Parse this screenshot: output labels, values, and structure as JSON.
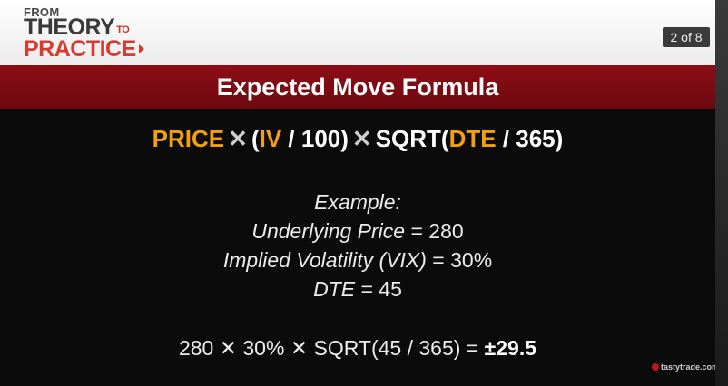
{
  "header": {
    "logo_line1": "FROM",
    "logo_line2": "THEORY",
    "logo_to": "TO",
    "logo_line3": "PRACTICE",
    "page_indicator": "2 of 8"
  },
  "title": "Expected Move Formula",
  "formula": {
    "price": "PRICE",
    "times1": "✕",
    "open_paren": "(",
    "iv": "IV",
    "iv_divisor": " / 100)",
    "times2": "✕",
    "sqrt_open": "SQRT(",
    "dte": "DTE",
    "dte_divisor": " / 365)"
  },
  "example": {
    "heading": "Example:",
    "price_label": "Underlying Price",
    "price_value": " = 280",
    "iv_label": "Implied Volatility (VIX)",
    "iv_value": " = 30%",
    "dte_label": "DTE",
    "dte_value": " = 45"
  },
  "calculation": {
    "expression": "280 ✕ 30% ✕ SQRT(45 / 365) = ",
    "result": "±29.5"
  },
  "brand": "tastytrade.com",
  "colors": {
    "accent_orange": "#f3a00f",
    "title_red": "#7d0b13",
    "logo_red": "#d73b2f"
  }
}
